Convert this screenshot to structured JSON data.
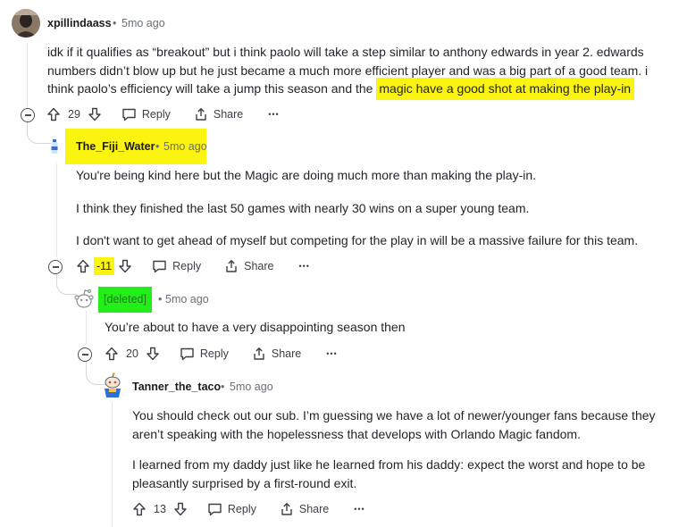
{
  "comments": [
    {
      "username": "xpillindaass",
      "separator": "•",
      "time": "5mo ago",
      "body_plain": "idk if it qualifies as “breakout” but i think paolo will take a step similar to anthony edwards in year 2. edwards numbers didn’t blow up but he just became a much more efficient player and was a big part of a good team. i think paolo’s efficiency will take a jump this season and the ",
      "body_highlight": "magic have a good shot at making the play-in",
      "votes": "29",
      "reply_label": "Reply",
      "share_label": "Share",
      "more_label": "•••"
    },
    {
      "username": "The_Fiji_Water",
      "separator": "•",
      "time": "5mo ago",
      "paragraphs": [
        "You're being kind here but the Magic are doing much more than making the play-in.",
        "I think they finished the last 50 games with nearly 30 wins on a super young team.",
        "I don't want to get ahead of myself but competing for the play in will be a massive failure for this team."
      ],
      "votes": "-11",
      "reply_label": "Reply",
      "share_label": "Share",
      "more_label": "•••"
    },
    {
      "username": "[deleted]",
      "separator": "•",
      "time": "5mo ago",
      "paragraphs": [
        "You’re about to have a very disappointing season then"
      ],
      "votes": "20",
      "reply_label": "Reply",
      "share_label": "Share",
      "more_label": "•••"
    },
    {
      "username": "Tanner_the_taco",
      "separator": "•",
      "time": "5mo ago",
      "paragraphs": [
        "You should check out our sub. I’m guessing we have a lot of newer/younger fans because they aren’t speaking with the hopelessness that develops with Orlando Magic fandom.",
        "I learned from my daddy just like he learned from his daddy: expect the worst and hope to be pleasantly surprised by a first-round exit."
      ],
      "votes": "13",
      "reply_label": "Reply",
      "share_label": "Share",
      "more_label": "•••"
    }
  ],
  "colors": {
    "highlight_yellow": "#fbf310",
    "highlight_green": "#23ee18",
    "text": "#1f2328",
    "meta": "#6a7077"
  }
}
